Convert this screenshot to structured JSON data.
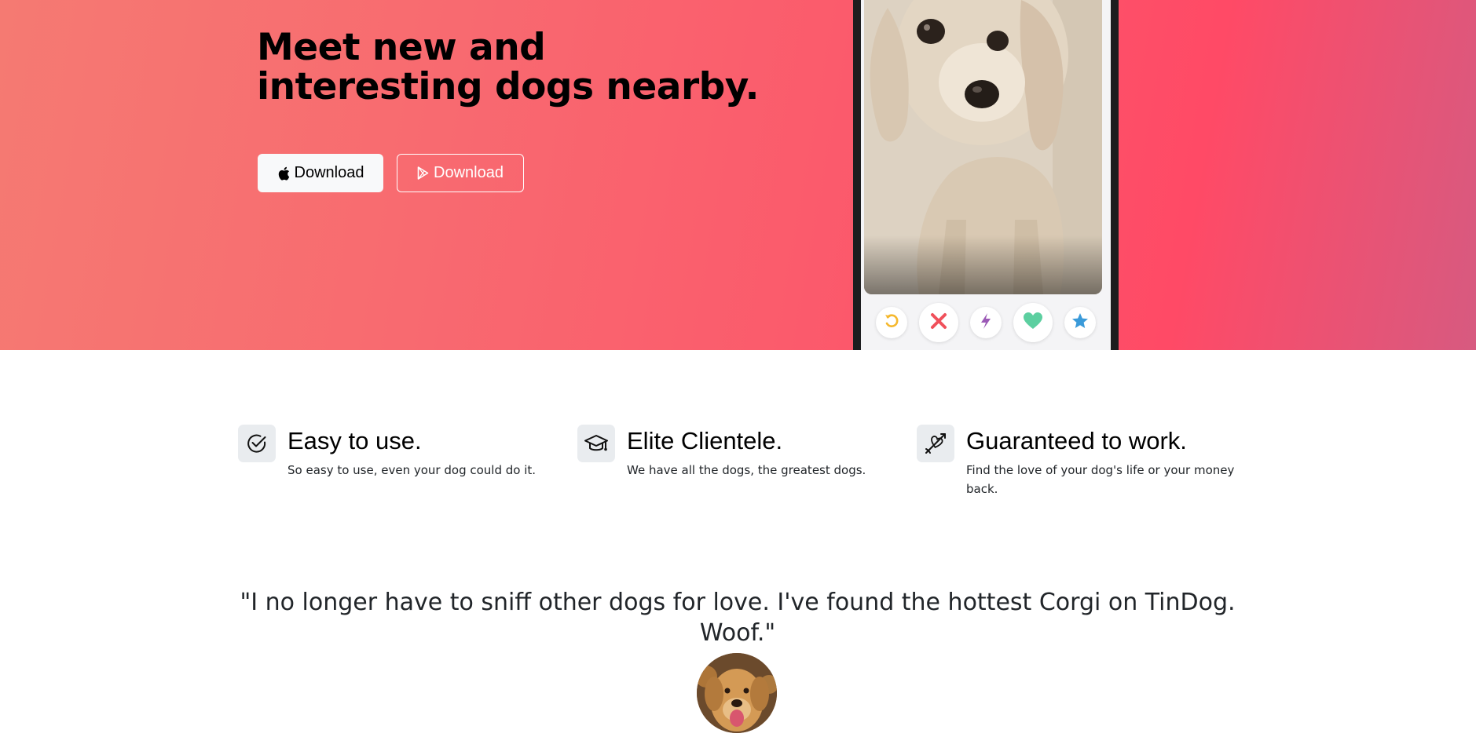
{
  "hero": {
    "title": "Meet new and interesting dogs nearby.",
    "buttons": [
      {
        "label": "Download",
        "icon": "apple-icon"
      },
      {
        "label": "Download",
        "icon": "google-play-icon"
      }
    ],
    "gradient_colors": [
      "#f57a72",
      "#ff4a66",
      "#d75a80"
    ]
  },
  "phone": {
    "actions": [
      {
        "icon": "rewind-icon",
        "color": "#f5b82e"
      },
      {
        "icon": "close-icon",
        "color": "#f0505b"
      },
      {
        "icon": "boost-icon",
        "color": "#9b59b6"
      },
      {
        "icon": "heart-icon",
        "color": "#5ccfa0"
      },
      {
        "icon": "star-icon",
        "color": "#3a9ad9"
      }
    ]
  },
  "features": [
    {
      "icon": "check-circle-icon",
      "title": "Easy to use.",
      "text": "So easy to use, even your dog could do it."
    },
    {
      "icon": "graduation-cap-icon",
      "title": "Elite Clientele.",
      "text": "We have all the dogs, the greatest dogs."
    },
    {
      "icon": "heart-arrow-icon",
      "title": "Guaranteed to work.",
      "text": "Find the love of your dog's life or your money back."
    }
  ],
  "testimonial": {
    "quote": "\"I no longer have to sniff other dogs for love. I've found the hottest Corgi on TinDog. Woof.\""
  }
}
